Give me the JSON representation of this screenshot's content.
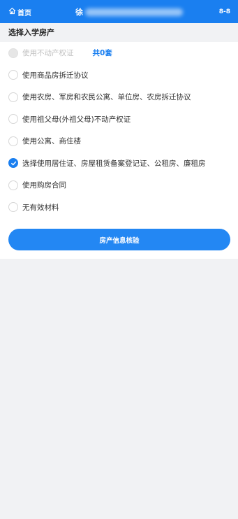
{
  "header": {
    "home_label": "首页",
    "title": "徐",
    "page_code": "8-8",
    "background_color": "#1a7ff0"
  },
  "section": {
    "title": "选择入学房产"
  },
  "options": [
    {
      "label": "使用不动产权证",
      "state": "disabled",
      "extra": "共0套"
    },
    {
      "label": "使用商品房拆迁协议",
      "state": "unchecked"
    },
    {
      "label": "使用农房、军房和农民公寓、单位房、农房拆迁协议",
      "state": "unchecked"
    },
    {
      "label": "使用祖父母(外祖父母)不动产权证",
      "state": "unchecked"
    },
    {
      "label": "使用公寓、商住楼",
      "state": "unchecked"
    },
    {
      "label": "选择使用居住证、房屋租赁备案登记证、公租房、廉租房",
      "state": "checked"
    },
    {
      "label": "使用购房合同",
      "state": "unchecked"
    },
    {
      "label": "无有效材料",
      "state": "unchecked"
    }
  ],
  "actions": {
    "verify_label": "房产信息核验"
  }
}
